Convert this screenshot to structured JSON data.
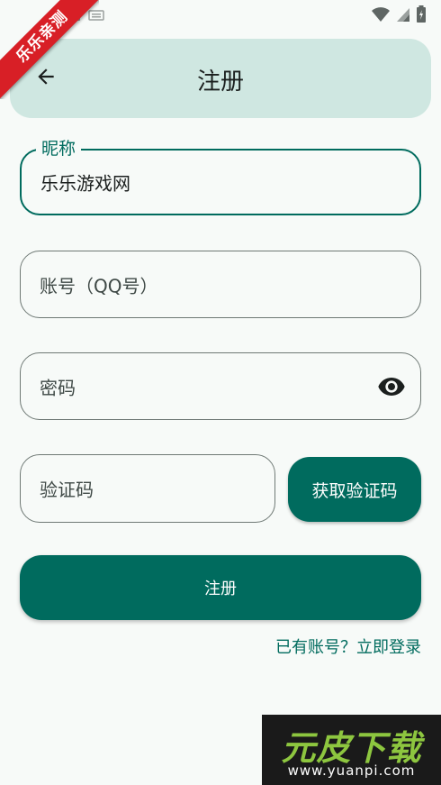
{
  "ribbon": {
    "text": "乐乐亲测"
  },
  "status_bar": {
    "icons_left": [
      "image-icon",
      "keyboard-icon"
    ],
    "icons_right": [
      "wifi-icon",
      "signal-icon",
      "battery-icon"
    ]
  },
  "app_bar": {
    "title": "注册",
    "back_icon": "arrow-left-icon"
  },
  "form": {
    "nickname": {
      "label": "昵称",
      "value": "乐乐游戏网"
    },
    "account": {
      "placeholder": "账号（QQ号）",
      "value": ""
    },
    "password": {
      "placeholder": "密码",
      "value": "",
      "toggle_icon": "eye-icon"
    },
    "code": {
      "placeholder": "验证码",
      "value": ""
    },
    "get_code_label": "获取验证码",
    "register_label": "注册",
    "login_link": "已有账号？立即登录"
  },
  "watermark": {
    "logo": "元皮下载",
    "url": "www.yuanpi.com"
  },
  "colors": {
    "primary": "#006b5e",
    "app_bar_bg": "#cfe7e1",
    "background": "#f7faf8",
    "ribbon": "#d81f26"
  }
}
